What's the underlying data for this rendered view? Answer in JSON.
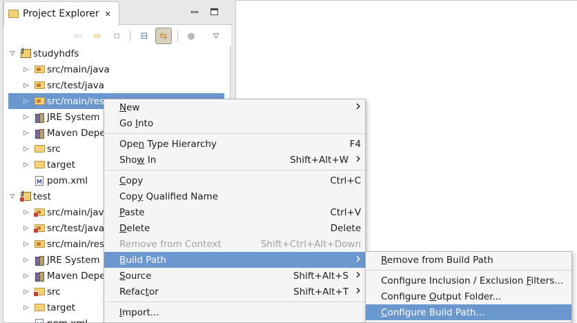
{
  "panel": {
    "title": "Project Explorer",
    "close_glyph": "✕",
    "minimize_glyph": "▭",
    "maximize_glyph": "▢"
  },
  "toolbar": {
    "icons": [
      "back-icon",
      "forward-icon",
      "up-icon",
      "collapse-all-icon",
      "link-with-editor-icon",
      "filter-icon",
      "view-menu-icon"
    ]
  },
  "tree": [
    {
      "label": "studyhdfs",
      "icon": "project-icon",
      "expanded": true,
      "level": 0
    },
    {
      "label": "src/main/java",
      "icon": "source-folder-icon",
      "level": 1
    },
    {
      "label": "src/test/java",
      "icon": "source-folder-icon",
      "level": 1
    },
    {
      "label": "src/main/res",
      "icon": "source-folder-icon",
      "level": 1,
      "selected": true
    },
    {
      "label": "JRE System L",
      "icon": "library-icon",
      "level": 1
    },
    {
      "label": "Maven Depe",
      "icon": "library-icon",
      "level": 1
    },
    {
      "label": "src",
      "icon": "folder-icon",
      "level": 1
    },
    {
      "label": "target",
      "icon": "folder-icon",
      "level": 1
    },
    {
      "label": "pom.xml",
      "icon": "xml-file-icon",
      "level": 1,
      "leaf": true
    },
    {
      "label": "test",
      "icon": "project-error-icon",
      "expanded": true,
      "level": 0
    },
    {
      "label": "src/main/java",
      "icon": "source-folder-error-icon",
      "level": 1
    },
    {
      "label": "src/test/java",
      "icon": "source-folder-error-icon",
      "level": 1
    },
    {
      "label": "src/main/res",
      "icon": "source-folder-icon",
      "level": 1
    },
    {
      "label": "JRE System L",
      "icon": "library-icon",
      "level": 1
    },
    {
      "label": "Maven Depe",
      "icon": "library-icon",
      "level": 1
    },
    {
      "label": "src",
      "icon": "folder-error-icon",
      "level": 1
    },
    {
      "label": "target",
      "icon": "folder-icon",
      "level": 1
    },
    {
      "label": "pom.xml",
      "icon": "xml-file-icon",
      "level": 1,
      "leaf": true
    }
  ],
  "context_menu": {
    "items": [
      {
        "label": "New",
        "mnemonic": "N",
        "key": "",
        "submenu": true
      },
      {
        "label": "Go Into",
        "mnemonic": "I",
        "key": ""
      },
      {
        "sep": true
      },
      {
        "label": "Open Type Hierarchy",
        "mnemonic": "n",
        "key": "F4"
      },
      {
        "label": "Show In",
        "mnemonic": "w",
        "key": "Shift+Alt+W",
        "submenu": true
      },
      {
        "sep": true
      },
      {
        "label": "Copy",
        "mnemonic": "C",
        "key": "Ctrl+C"
      },
      {
        "label": "Copy Qualified Name",
        "mnemonic": "y",
        "key": ""
      },
      {
        "label": "Paste",
        "mnemonic": "P",
        "key": "Ctrl+V"
      },
      {
        "label": "Delete",
        "mnemonic": "D",
        "key": "Delete"
      },
      {
        "label": "Remove from Context",
        "key": "Shift+Ctrl+Alt+Down",
        "disabled": true
      },
      {
        "label": "Build Path",
        "mnemonic": "B",
        "key": "",
        "submenu": true,
        "highlighted": true
      },
      {
        "label": "Source",
        "mnemonic": "S",
        "key": "Shift+Alt+S",
        "submenu": true
      },
      {
        "label": "Refactor",
        "mnemonic": "t",
        "key": "Shift+Alt+T",
        "submenu": true
      },
      {
        "sep": true
      },
      {
        "label": "Import...",
        "mnemonic": "I",
        "key": ""
      }
    ]
  },
  "build_path_menu": {
    "items": [
      {
        "label": "Remove from Build Path",
        "mnemonic": "R"
      },
      {
        "sep": true
      },
      {
        "label": "Configure Inclusion / Exclusion Filters...",
        "mnemonic": "F"
      },
      {
        "label": "Configure Output Folder...",
        "mnemonic": "O"
      },
      {
        "label": "Configure Build Path...",
        "mnemonic": "C",
        "highlighted": true
      }
    ]
  }
}
